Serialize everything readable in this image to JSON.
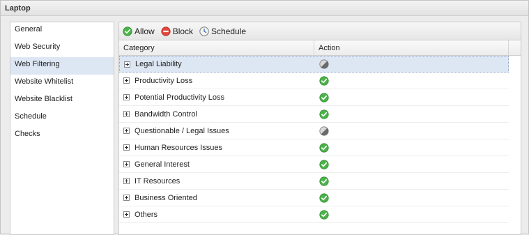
{
  "window": {
    "title": "Laptop"
  },
  "sidebar": {
    "items": [
      {
        "label": "General"
      },
      {
        "label": "Web Security"
      },
      {
        "label": "Web Filtering"
      },
      {
        "label": "Website Whitelist"
      },
      {
        "label": "Website Blacklist"
      },
      {
        "label": "Schedule"
      },
      {
        "label": "Checks"
      }
    ],
    "selected": "Web Filtering"
  },
  "toolbar": {
    "allow_label": "Allow",
    "block_label": "Block",
    "schedule_label": "Schedule"
  },
  "grid": {
    "columns": {
      "category": "Category",
      "action": "Action"
    },
    "rows": [
      {
        "category": "Legal Liability",
        "action": "neutral-icon"
      },
      {
        "category": "Productivity Loss",
        "action": "allow-icon"
      },
      {
        "category": "Potential Productivity Loss",
        "action": "allow-icon"
      },
      {
        "category": "Bandwidth Control",
        "action": "allow-icon"
      },
      {
        "category": "Questionable / Legal Issues",
        "action": "neutral-icon"
      },
      {
        "category": "Human Resources Issues",
        "action": "allow-icon"
      },
      {
        "category": "General Interest",
        "action": "allow-icon"
      },
      {
        "category": "IT Resources",
        "action": "allow-icon"
      },
      {
        "category": "Business Oriented",
        "action": "allow-icon"
      },
      {
        "category": "Others",
        "action": "allow-icon"
      }
    ],
    "selected_row": "Legal Liability"
  },
  "colors": {
    "selection": "#dde6f3",
    "allow": "#3aa23a",
    "block": "#d43b2f",
    "neutral": "#8a8a8a"
  }
}
